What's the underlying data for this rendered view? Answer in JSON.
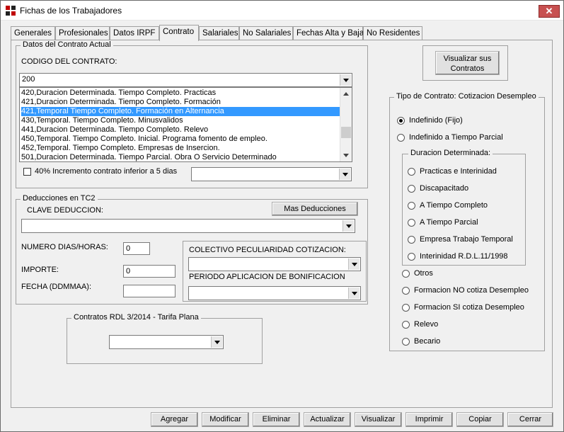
{
  "window": {
    "title": "Fichas de los Trabajadores",
    "close_glyph": "✕"
  },
  "tabs": [
    "Generales",
    "Profesionales",
    "Datos IRPF",
    "Contrato",
    "Salariales",
    "No Salariales",
    "Fechas Alta y Baja",
    "No Residentes"
  ],
  "active_tab": "Contrato",
  "contract": {
    "group_title": "Datos del Contrato Actual",
    "code_label": "CODIGO DEL CONTRATO:",
    "code_value": "200",
    "list_items": [
      "420,Duracion Determinada. Tiempo Completo. Practicas",
      "421,Duracion Determinada. Tiempo Completo. Formación",
      "421,Temporal Tiempo Completo. Formación en Alternancia",
      "430,Temporal. Tiempo Completo. Minusvalidos",
      "441,Duracion Determinada. Tiempo Completo. Relevo",
      "450,Temporal. Tiempo Completo. Inicial. Programa fomento de empleo.",
      "452,Temporal. Tiempo Completo. Empresas de Insercion.",
      "501,Duracion Determinada. Tiempo Parcial. Obra O Servicio Determinado"
    ],
    "selected_index": 2,
    "increment_label": "40% Incremento contrato inferior a 5 dias"
  },
  "visualizar_contratos": {
    "line1": "Visualizar sus",
    "line2": "Contratos"
  },
  "deducciones": {
    "group_title": "Deducciones en TC2",
    "clave_label": "CLAVE DEDUCCION:",
    "mas_button": "Mas Deducciones",
    "numero_label": "NUMERO DIAS/HORAS:",
    "numero_value": "0",
    "importe_label": "IMPORTE:",
    "importe_value": "0",
    "fecha_label": "FECHA (DDMMAA):",
    "fecha_value": "",
    "colectivo_label": "COLECTIVO PECULIARIDAD COTIZACION:",
    "periodo_label": "PERIODO APLICACION DE BONIFICACION"
  },
  "rdl": {
    "group_title": "Contratos RDL  3/2014  -  Tarifa Plana"
  },
  "tipo_contrato": {
    "group_title": "Tipo de Contrato: Cotizacion Desempleo",
    "indefinido": "Indefinido (Fijo)",
    "indefinido_parcial": "Indefinido a Tiempo Parcial",
    "duracion_title": "Duracion Determinada:",
    "duracion_options": [
      "Practicas e Interinidad",
      "Discapacitado",
      "A Tiempo Completo",
      "A Tiempo Parcial",
      "Empresa Trabajo Temporal",
      "Interinidad R.D.L.11/1998"
    ],
    "other_options": [
      "Otros",
      "Formacion NO cotiza Desempleo",
      "Formacion SI cotiza Desempleo",
      "Relevo",
      "Becario"
    ]
  },
  "buttons": {
    "agregar": "Agregar",
    "modificar": "Modificar",
    "eliminar": "Eliminar",
    "actualizar": "Actualizar",
    "visualizar": "Visualizar",
    "imprimir": "Imprimir",
    "copiar": "Copiar",
    "cerrar": "Cerrar"
  }
}
